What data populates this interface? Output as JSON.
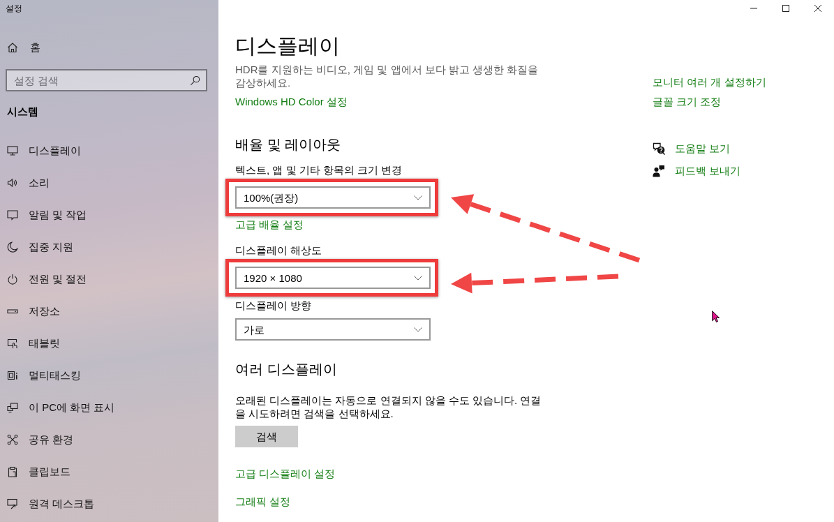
{
  "window": {
    "title": "설정"
  },
  "sidebar": {
    "home": {
      "label": "홈"
    },
    "search": {
      "placeholder": "설정 검색"
    },
    "section_title": "시스템",
    "items": [
      {
        "label": "디스플레이"
      },
      {
        "label": "소리"
      },
      {
        "label": "알림 및 작업"
      },
      {
        "label": "집중 지원"
      },
      {
        "label": "전원 및 절전"
      },
      {
        "label": "저장소"
      },
      {
        "label": "태블릿"
      },
      {
        "label": "멀티태스킹"
      },
      {
        "label": "이 PC에 화면 표시"
      },
      {
        "label": "공유 환경"
      },
      {
        "label": "클립보드"
      },
      {
        "label": "원격 데스크톱"
      }
    ]
  },
  "page": {
    "title": "디스플레이",
    "blocks": [
      {
        "kind": "description",
        "text": "HDR를 지원하는 비디오, 게임 및 앱에서 보다 밝고 생생한 화질을 감상하세요."
      },
      {
        "kind": "link",
        "text": "Windows HD Color 설정"
      },
      {
        "kind": "heading",
        "text": "배율 및 레이아웃"
      },
      {
        "kind": "label",
        "text": "텍스트, 앱 및 기타 항목의 크기 변경"
      },
      {
        "kind": "dropdown",
        "value": "100%(권장)",
        "highlighted": true
      },
      {
        "kind": "link",
        "text": "고급 배율 설정"
      },
      {
        "kind": "label",
        "text": "디스플레이 해상도"
      },
      {
        "kind": "dropdown",
        "value": "1920 × 1080",
        "highlighted": true
      },
      {
        "kind": "label",
        "text": "디스플레이 방향"
      },
      {
        "kind": "dropdown",
        "value": "가로",
        "highlighted": false
      },
      {
        "kind": "heading",
        "text": "여러 디스플레이"
      },
      {
        "kind": "text",
        "text": "오래된 디스플레이는 자동으로 연결되지 않을 수도 있습니다. 연결을 시도하려면 검색을 선택하세요."
      },
      {
        "kind": "button",
        "text": "검색"
      },
      {
        "kind": "link",
        "text": "고급 디스플레이 설정"
      },
      {
        "kind": "link",
        "text": "그래픽 설정"
      }
    ]
  },
  "related": {
    "links": [
      {
        "label": "모니터 여러 개 설정하기"
      },
      {
        "label": "글꼴 크기 조정"
      }
    ],
    "help": [
      {
        "label": "도움말 보기"
      },
      {
        "label": "피드백 보내기"
      }
    ]
  }
}
